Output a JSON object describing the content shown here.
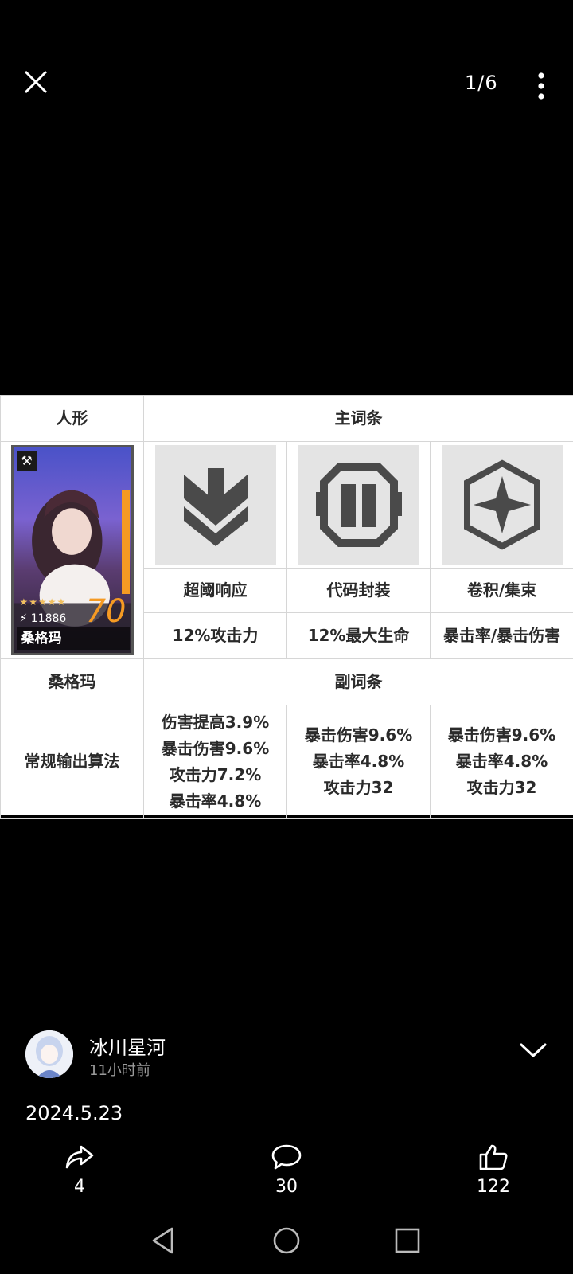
{
  "viewer": {
    "counter": "1/6",
    "icons": {
      "close": "close-icon",
      "more": "more-vertical-icon"
    }
  },
  "figure": {
    "header_left": "人形",
    "header_main": "主词条",
    "card": {
      "name": "桑格玛",
      "level": "70",
      "power": "11886",
      "stars": "★★★★★",
      "role_icon": "⚒"
    },
    "main_stats": [
      {
        "icon": "chevron-rank-icon",
        "name": "超阈响应",
        "stat": "12%攻击力"
      },
      {
        "icon": "shield-module-icon",
        "name": "代码封装",
        "stat": "12%最大生命"
      },
      {
        "icon": "compass-star-icon",
        "name": "卷积/集束",
        "stat": "暴击率/暴击伤害"
      }
    ],
    "character_name": "桑格玛",
    "sub_header": "副词条",
    "algorithm_label": "常规输出算法",
    "sub_stats": [
      [
        "伤害提高3.9%",
        "暴击伤害9.6%",
        "攻击力7.2%",
        "暴击率4.8%"
      ],
      [
        "暴击伤害9.6%",
        "暴击率4.8%",
        "攻击力32"
      ],
      [
        "暴击伤害9.6%",
        "暴击率4.8%",
        "攻击力32"
      ]
    ]
  },
  "post": {
    "author": "冰川星河",
    "time": "11小时前",
    "text": "2024.5.23"
  },
  "actions": {
    "share": "4",
    "comment": "30",
    "like": "122"
  },
  "colors": {
    "background": "#000000",
    "text": "#ffffff",
    "muted": "#9a9a9a",
    "accent_orange": "#f59a23"
  }
}
